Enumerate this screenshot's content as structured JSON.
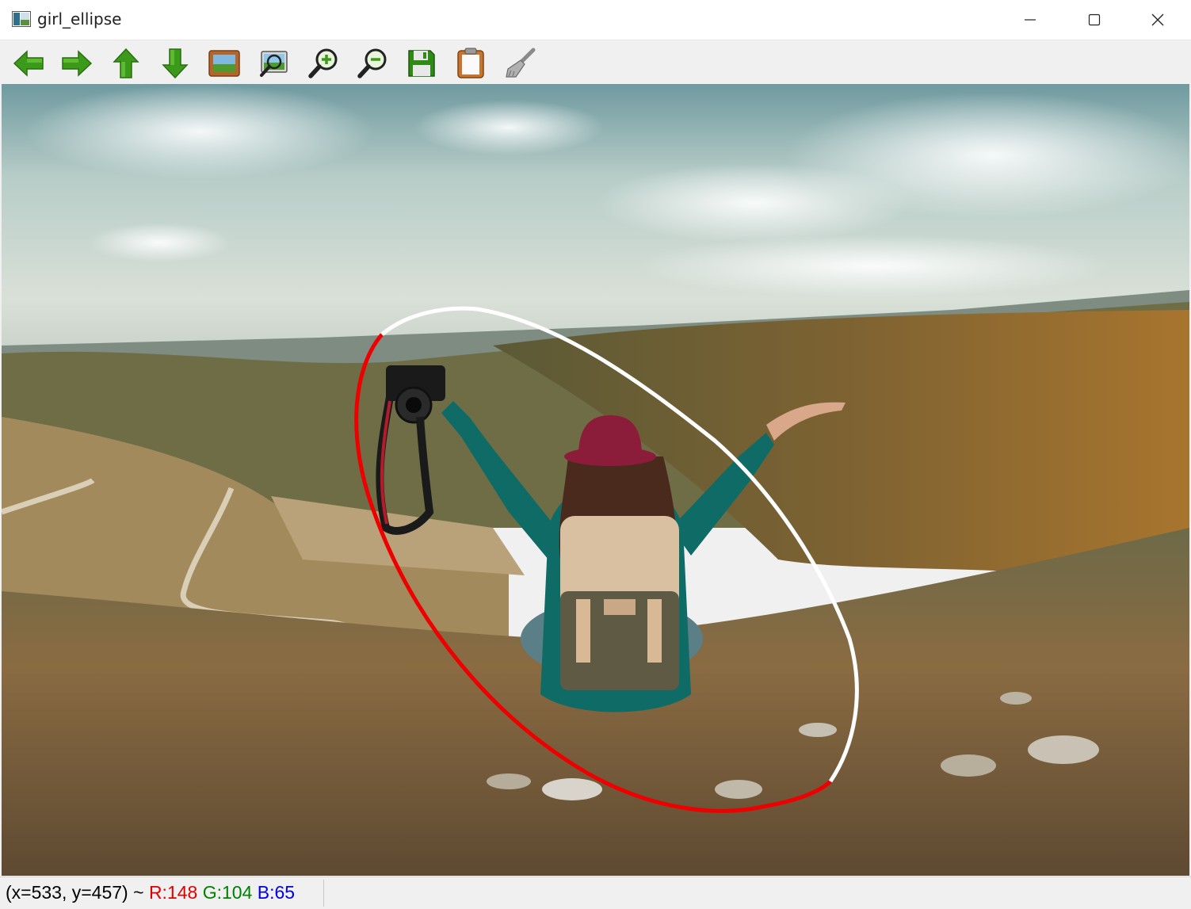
{
  "window": {
    "title": "girl_ellipse"
  },
  "toolbar": {
    "buttons": [
      {
        "name": "pan-left-button",
        "icon": "arrow-left-icon"
      },
      {
        "name": "pan-right-button",
        "icon": "arrow-right-icon"
      },
      {
        "name": "pan-up-button",
        "icon": "arrow-up-icon"
      },
      {
        "name": "pan-down-button",
        "icon": "arrow-down-icon"
      },
      {
        "name": "zoom-fit-button",
        "icon": "picture-frame-icon"
      },
      {
        "name": "zoom-original-button",
        "icon": "picture-magnify-icon"
      },
      {
        "name": "zoom-in-button",
        "icon": "zoom-in-icon"
      },
      {
        "name": "zoom-out-button",
        "icon": "zoom-out-icon"
      },
      {
        "name": "save-button",
        "icon": "floppy-disk-icon"
      },
      {
        "name": "copy-clipboard-button",
        "icon": "clipboard-icon"
      },
      {
        "name": "properties-button",
        "icon": "brush-icon"
      }
    ]
  },
  "status": {
    "coords": "(x=533, y=457) ~ ",
    "r": "R:148",
    "g": "G:104",
    "b": "B:65"
  },
  "colors": {
    "arrow_green": "#3c9a1a",
    "status_r": "#e00000",
    "status_g": "#008000",
    "status_b": "#0000e0",
    "ellipse_red": "#ee0000",
    "ellipse_white": "#ffffff"
  }
}
